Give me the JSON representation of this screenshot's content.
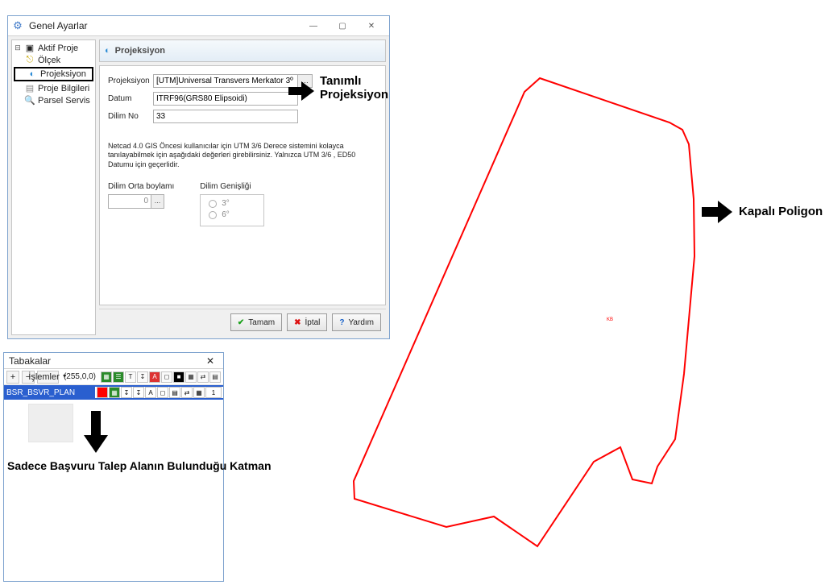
{
  "settings_window": {
    "title": "Genel Ayarlar",
    "tree": {
      "root": "Aktif Proje",
      "items": [
        "Ölçek",
        "Projeksiyon",
        "Proje Bilgileri",
        "Parsel Servis"
      ]
    },
    "panel_title": "Projeksiyon",
    "form": {
      "projection_label": "Projeksiyon",
      "projection_value": "[UTM]Universal Transvers Merkator 3º",
      "datum_label": "Datum",
      "datum_value": "ITRF96(GRS80 Elipsoidi)",
      "zone_label": "Dilim No",
      "zone_value": "33"
    },
    "info_text": "Netcad 4.0 GIS Öncesi kullanıcılar için UTM 3/6 Derece sistemini kolayca tanılayabilmek için aşağıdaki değerleri girebilirsiniz. Yalnızca UTM 3/6 , ED50 Datumu için geçerlidir.",
    "meridian_label": "Dilim Orta boylamı",
    "meridian_value": "0",
    "width_label": "Dilim Genişliği",
    "width_options": [
      "3°",
      "6°"
    ],
    "buttons": {
      "ok": "Tamam",
      "cancel": "İptal",
      "help": "Yardım"
    }
  },
  "layers_window": {
    "title": "Tabakalar",
    "ops_label": "İşlemler",
    "rgb_text": "(255,0,0)",
    "layer_name": "BSR_BSVR_PLAN",
    "count_value": "1"
  },
  "annotations": {
    "projection_defined": "Tanımlı\nProjeksiyon",
    "closed_polygon": "Kapalı Poligon",
    "single_layer": "Sadece Başvuru Talep Alanın Bulunduğu Katman"
  },
  "polygon": {
    "center_label": "KB"
  }
}
